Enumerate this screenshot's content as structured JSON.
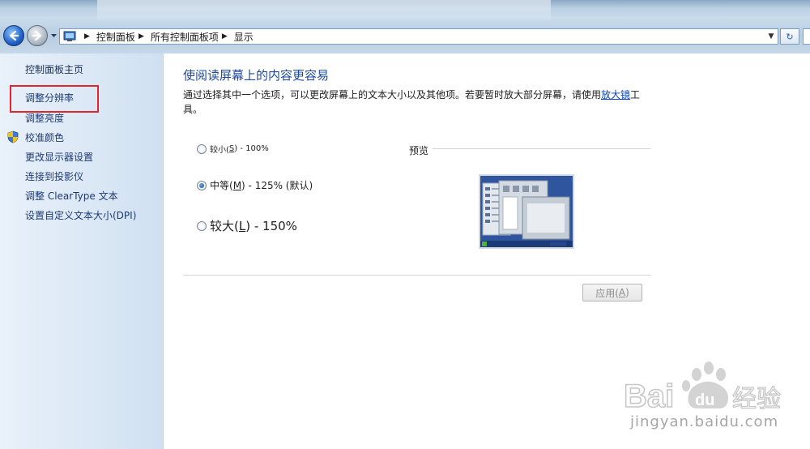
{
  "address": {
    "breadcrumbs": [
      "控制面板",
      "所有控制面板项",
      "显示"
    ]
  },
  "sidebar": {
    "home": "控制面板主页",
    "items": [
      {
        "label": "调整分辨率"
      },
      {
        "label": "调整亮度"
      },
      {
        "label": "校准颜色",
        "icon": "shield-icon"
      },
      {
        "label": "更改显示器设置"
      },
      {
        "label": "连接到投影仪"
      },
      {
        "label": "调整 ClearType 文本"
      },
      {
        "label": "设置自定义文本大小(DPI)"
      }
    ]
  },
  "main": {
    "title": "使阅读屏幕上的内容更容易",
    "description_before": "通过选择其中一个选项，可以更改屏幕上的文本大小以及其他项。若要暂时放大部分屏幕，请使用",
    "description_link": "放大镜",
    "description_after": "工具。",
    "options": [
      {
        "label": "较小(",
        "key": "S",
        "suffix": ") - 100%",
        "selected": false
      },
      {
        "label": "中等(",
        "key": "M",
        "suffix": ") - 125% (默认)",
        "selected": true
      },
      {
        "label": "较大(",
        "key": "L",
        "suffix": ") - 150%",
        "selected": false
      }
    ],
    "preview_label": "预览",
    "apply_label": "应用(",
    "apply_key": "A",
    "apply_suffix": ")"
  },
  "watermark": {
    "brand": "Bai du 经验",
    "url": "jingyan.baidu.com"
  },
  "colors": {
    "link": "#0a44c8",
    "title": "#1b4aa0",
    "highlight_box": "#e0252b"
  }
}
